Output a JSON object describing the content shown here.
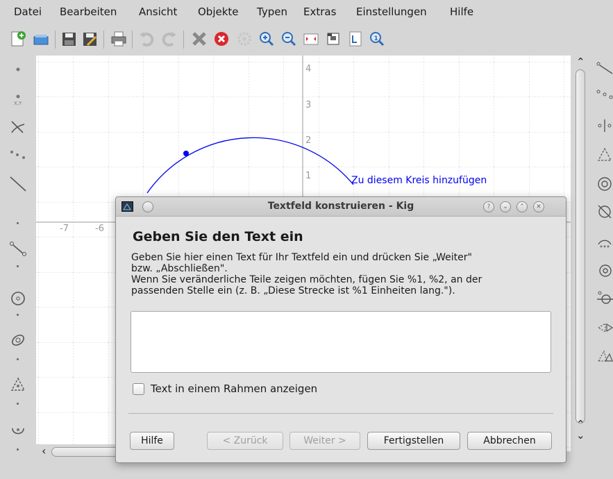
{
  "menu": [
    "Datei",
    "Bearbeiten",
    "Ansicht",
    "Objekte",
    "Typen",
    "Extras",
    "Einstellungen",
    "Hilfe"
  ],
  "toolbar_icons": [
    "new-document-icon",
    "open-icon",
    "save-icon",
    "save-as-icon",
    "print-icon",
    "undo-icon",
    "redo-icon",
    "delete-icon",
    "cancel-icon",
    "settings-icon",
    "zoom-in-icon",
    "zoom-out-icon",
    "fit-to-page-icon",
    "export-icon",
    "properties-icon",
    "zoom-icon"
  ],
  "canvas": {
    "y_axis_labels": [
      "4",
      "3",
      "2",
      "1"
    ],
    "x_axis_labels": [
      "-7",
      "-6"
    ],
    "circle_label": "Zu diesem Kreis hinzufügen",
    "circle_color": "#0000ee"
  },
  "dialog": {
    "title": "Textfeld konstruieren - Kig",
    "heading": "Geben Sie den Text ein",
    "desc_lines": [
      "Geben Sie hier einen Text für Ihr Textfeld ein und drücken Sie „Weiter\"",
      "bzw. „Abschließen\".",
      "Wenn Sie veränderliche Teile zeigen möchten, fügen Sie %1, %2, an der",
      "passenden Stelle ein (z. B. „Diese Strecke ist %1 Einheiten lang.\")."
    ],
    "text_value": "",
    "checkbox_label": "Text in einem Rahmen anzeigen",
    "checkbox_checked": false,
    "buttons": {
      "help": "Hilfe",
      "back": "< Zurück",
      "next": "Weiter >",
      "finish": "Fertigstellen",
      "cancel": "Abbrechen"
    }
  }
}
